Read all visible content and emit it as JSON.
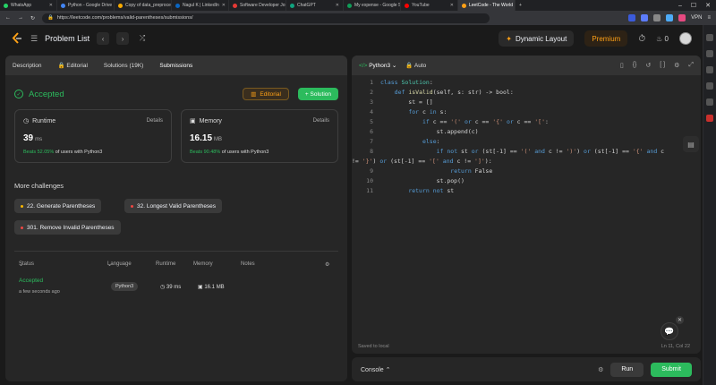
{
  "browser_tabs": [
    {
      "label": "WhatsApp",
      "color": "#25d366"
    },
    {
      "label": "Python - Google Drive",
      "color": "#4285f4"
    },
    {
      "label": "Copy of data_preprocessin",
      "color": "#f9ab00"
    },
    {
      "label": "Nagul K | LinkedIn",
      "color": "#0a66c2"
    },
    {
      "label": "Software Developer Jobs i",
      "color": "#e53935"
    },
    {
      "label": "ChatGPT",
      "color": "#10a37f"
    },
    {
      "label": "My expense - Google Shee",
      "color": "#0f9d58"
    },
    {
      "label": "YouTube",
      "color": "#ff0000"
    },
    {
      "label": "LeetCode - The World",
      "color": "#ffa116"
    }
  ],
  "window_vpn": "VPN",
  "url": "https://leetcode.com/problems/valid-parentheses/submissions/",
  "header": {
    "problem_list": "Problem List",
    "dynamic_layout": "Dynamic Layout",
    "premium": "Premium",
    "streak": "0"
  },
  "left_tabs": [
    "Description",
    "Editorial",
    "Solutions (19K)",
    "Submissions"
  ],
  "result": {
    "status": "Accepted",
    "editorial_btn": "Editorial",
    "solution_btn": "+ Solution"
  },
  "runtime": {
    "label": "Runtime",
    "details": "Details",
    "value": "39",
    "unit": "ms",
    "beats_pct": "Beats 52.05%",
    "beats_rest": "of users with Python3"
  },
  "memory": {
    "label": "Memory",
    "details": "Details",
    "value": "16.15",
    "unit": "MB",
    "beats_pct": "Beats 90.48%",
    "beats_rest": "of users with Python3"
  },
  "more_challenges": {
    "title": "More challenges",
    "items": [
      {
        "label": "22. Generate Parentheses",
        "color": "#ffb800"
      },
      {
        "label": "32. Longest Valid Parentheses",
        "color": "#ef4743"
      },
      {
        "label": "301. Remove Invalid Parentheses",
        "color": "#ef4743"
      }
    ]
  },
  "table": {
    "headers": [
      "Status",
      "Language",
      "Runtime",
      "Memory",
      "Notes"
    ],
    "row": {
      "status": "Accepted",
      "when": "a few seconds ago",
      "language": "Python3",
      "runtime": "39 ms",
      "memory": "16.1 MB"
    }
  },
  "editor": {
    "language": "Python3",
    "mode": "Auto",
    "saved": "Saved to local",
    "cursor": "Ln 11, Col 22",
    "line_numbers": [
      "1",
      "2",
      "3",
      "4",
      "5",
      "6",
      "7",
      "8",
      "9",
      "10",
      "11"
    ]
  },
  "console": {
    "label": "Console",
    "run": "Run",
    "submit": "Submit"
  },
  "colors": {
    "accent_green": "#2cbb5d",
    "accent_orange": "#ffa116",
    "bg": "#1a1a1a",
    "panel": "#262626"
  }
}
